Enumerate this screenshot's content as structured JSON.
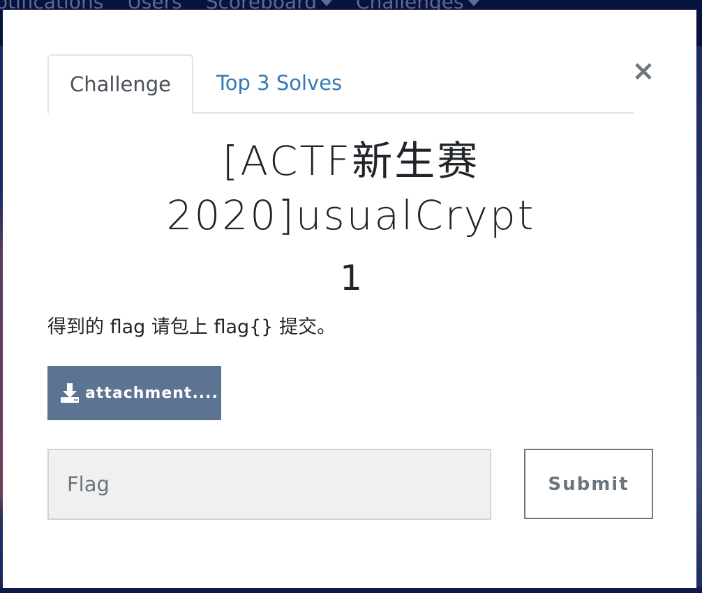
{
  "background_nav": {
    "items": [
      {
        "label": "otifications",
        "caret": false
      },
      {
        "label": "Users",
        "caret": false
      },
      {
        "label": "Scoreboard",
        "caret": true
      },
      {
        "label": "Challenges",
        "caret": true
      }
    ]
  },
  "modal": {
    "tabs": [
      {
        "label": "Challenge",
        "active": true
      },
      {
        "label": "Top 3 Solves",
        "active": false
      }
    ],
    "close_label": "×",
    "title_line1": "[ACTF新生赛",
    "title_line2": "2020]usualCrypt",
    "points": "1",
    "description": "得到的 flag 请包上 flag{} 提交。",
    "attachment_label": "attachment....",
    "attachment_icon": "download-icon",
    "flag_input": {
      "value": "",
      "placeholder": "Flag"
    },
    "submit_label": "Submit"
  },
  "colors": {
    "tab_link": "#337ab7",
    "attachment_button": "#5c7392",
    "submit_border": "#6c757d",
    "input_background": "#f0f0f0"
  }
}
